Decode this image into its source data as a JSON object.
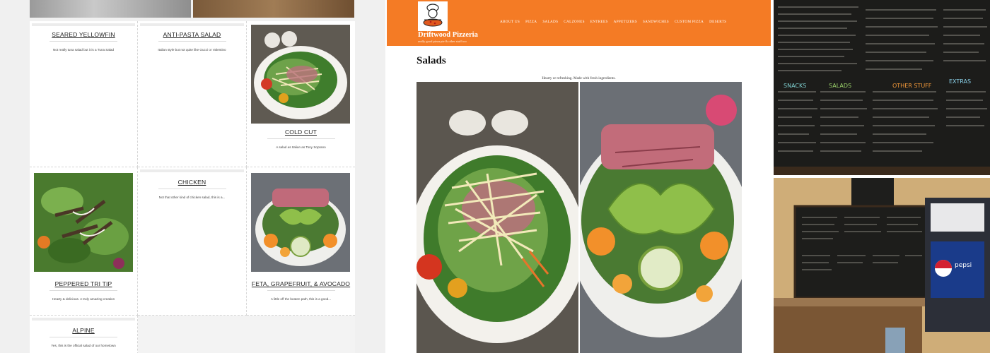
{
  "salad_grid": {
    "items": [
      {
        "title": "SEARED YELLOWFIN",
        "desc": "Not really tuna salad but it is a Tuna Salad"
      },
      {
        "title": "ANTI-PASTA SALAD",
        "desc": "Italian style but not quite like Gucci or Valentino"
      },
      {
        "title": "COLD CUT",
        "desc": "A salad as Italian as Tony Soprano"
      },
      {
        "title": "PEPPERED TRI TIP",
        "desc": "Hearty & delicious. A truly amazing creation"
      },
      {
        "title": "CHICKEN",
        "desc": "Not that other kind of chicken salad, this is a..."
      },
      {
        "title": "FETA, GRAPEFRUIT, & AVOCADO",
        "desc": "A little off the beaten path, this is a good..."
      },
      {
        "title": "ALPINE",
        "desc": "Yes, this is the official salad of our hometown"
      }
    ]
  },
  "site": {
    "name": "Driftwood Pizzeria",
    "tagline": "really good pizza pie & other stuff too",
    "nav": [
      "ABOUT US",
      "PIZZA",
      "SALADS",
      "CALZONES",
      "ENTREES",
      "APPETIZERS",
      "SANDWICHES",
      "CUSTOM PIZZA",
      "DESERTS"
    ],
    "heading": "Salads",
    "intro": "Hearty or refreshing. Made with fresh ingredients."
  },
  "colors": {
    "header_orange": "#f47b25",
    "chalkboard": "#1c1c1a"
  },
  "icons": {
    "logo": "chef-logo-icon"
  }
}
